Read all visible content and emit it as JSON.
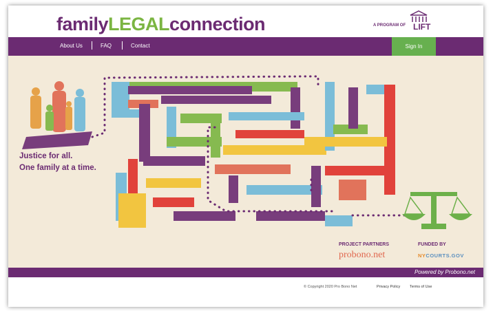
{
  "header": {
    "logo_part1": "family",
    "logo_part2": "LEGAL",
    "logo_part3": "connection",
    "program_of": "A PROGRAM OF",
    "lift": "LIFT"
  },
  "nav": {
    "about": "About Us",
    "faq": "FAQ",
    "contact": "Contact",
    "signin": "Sign In"
  },
  "hero": {
    "tagline_line1": "Justice for all.",
    "tagline_line2": "One family at a time."
  },
  "partners": {
    "label": "PROJECT PARTNERS",
    "probono": "probono.net",
    "funded_label": "FUNDED BY",
    "nycourts_ny": "NY",
    "nycourts_rest": "COURTS.GOV"
  },
  "footer": {
    "powered": "Powered by Probono.net",
    "copyright": "© Copyright 2020 Pro Bono Net",
    "privacy": "Privacy Policy",
    "terms": "Terms of Use"
  },
  "colors": {
    "brand_purple": "#6b2b72",
    "brand_green": "#7bb542",
    "signin_green": "#67b04f",
    "hero_bg": "#f3ead9"
  }
}
